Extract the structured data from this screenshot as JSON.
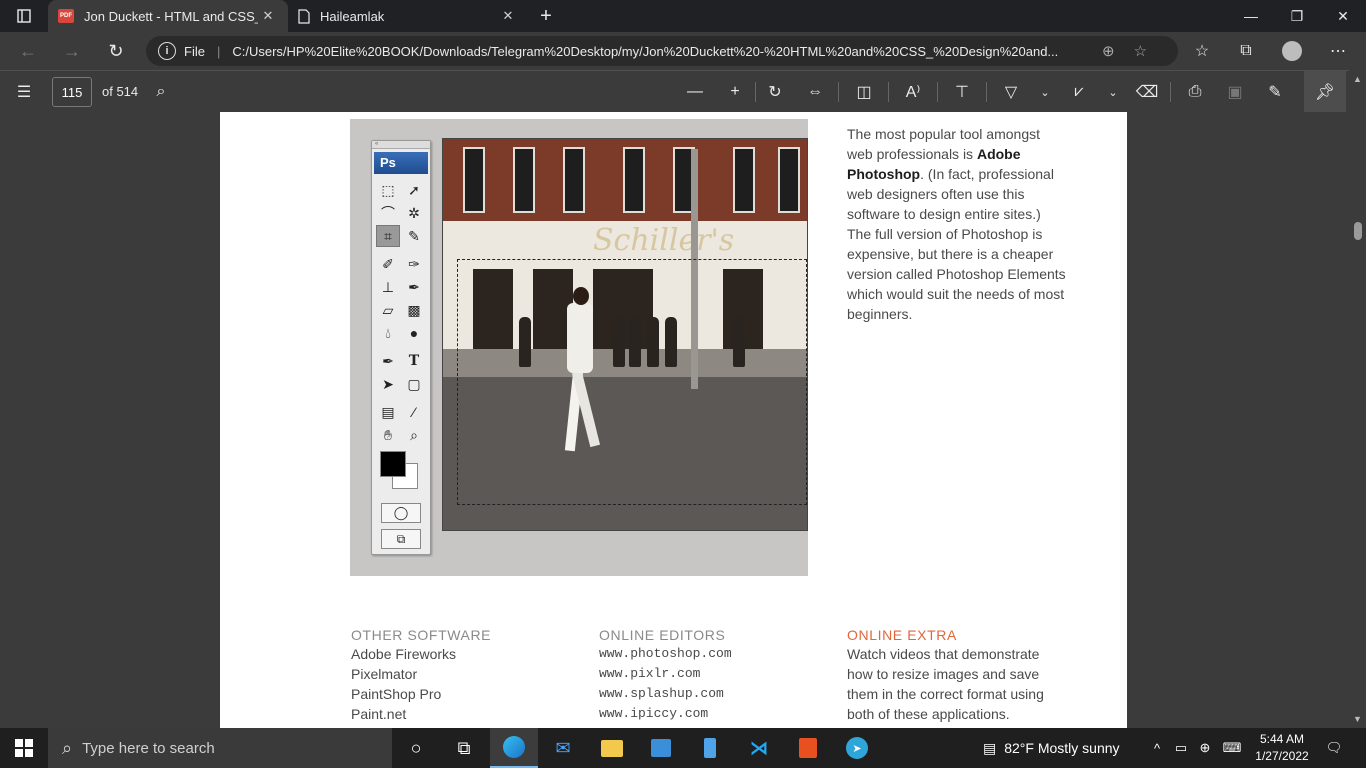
{
  "browser": {
    "tabs": [
      {
        "title": "Jon Duckett - HTML and CSS_ De",
        "icon": "pdf-icon",
        "active": true
      },
      {
        "title": "Haileamlak",
        "icon": "page-icon",
        "active": false
      }
    ],
    "address": {
      "scheme_label": "File",
      "url": "C:/Users/HP%20Elite%20BOOK/Downloads/Telegram%20Desktop/my/Jon%20Duckett%20-%20HTML%20and%20CSS_%20Design%20and..."
    }
  },
  "pdf_toolbar": {
    "page_number": "115",
    "page_total": "of 514"
  },
  "document": {
    "photoshop_logo": "Ps",
    "paragraph": {
      "part1": "The most popular tool amongst web professionals is ",
      "bold": "Adobe Photoshop",
      "part2": ". (In fact, professional web designers often use this software to design entire sites.) The full version of Photoshop is expensive, but there is a cheaper version called Photoshop Elements which would suit the needs of most beginners."
    },
    "photo_sign": "Schiller's",
    "columns": {
      "other_software": {
        "heading": "OTHER SOFTWARE",
        "items": [
          "Adobe Fireworks",
          "Pixelmator",
          "PaintShop Pro",
          "Paint.net"
        ]
      },
      "online_editors": {
        "heading": "ONLINE EDITORS",
        "items": [
          "www.photoshop.com",
          "www.pixlr.com",
          "www.splashup.com",
          "www.ipiccy.com"
        ]
      },
      "online_extra": {
        "heading": "ONLINE EXTRA",
        "text": "Watch videos that demonstrate how to resize images and save them in the correct format using both of these applications."
      }
    }
  },
  "taskbar": {
    "search_placeholder": "Type here to search",
    "weather": "82°F  Mostly sunny",
    "time": "5:44 AM",
    "date": "1/27/2022"
  },
  "colors": {
    "accent_heading": "#e0673c",
    "browser_bg": "#3b3b3b",
    "tab_strip": "#202124"
  }
}
